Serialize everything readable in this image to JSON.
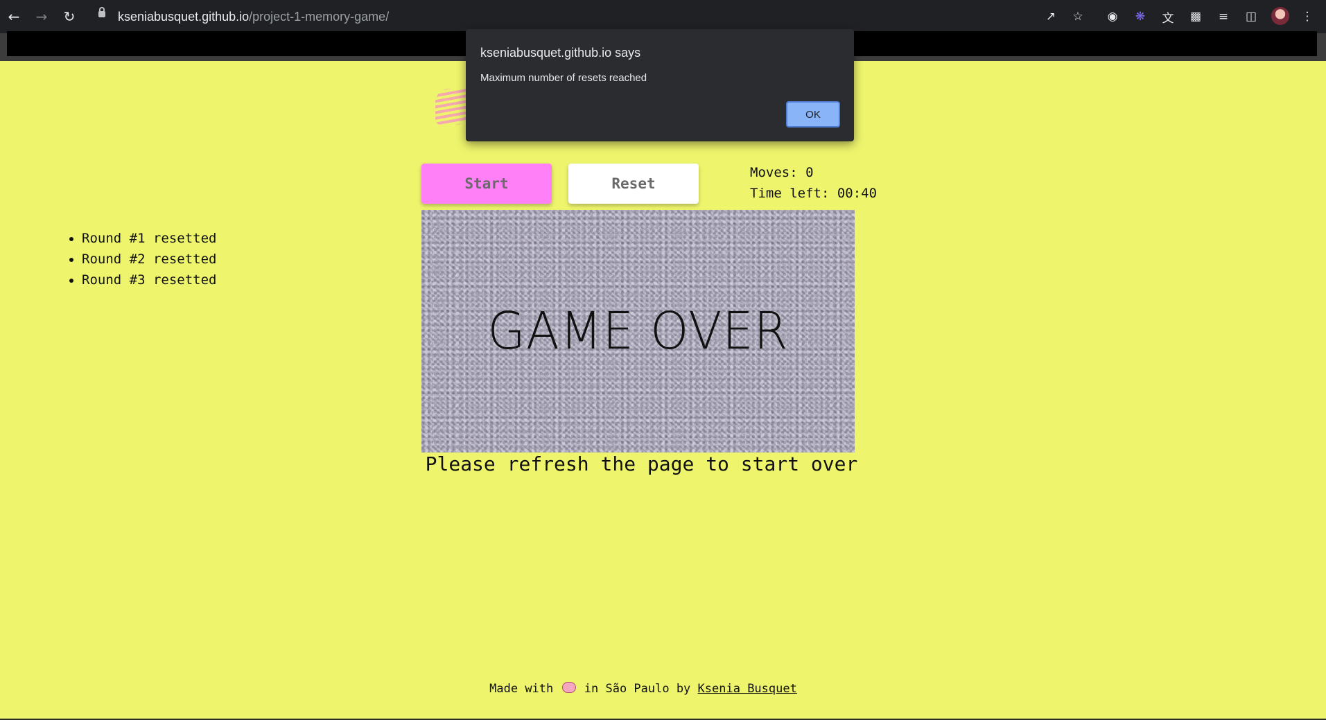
{
  "browser": {
    "url_host": "kseniabusquet.github.io",
    "url_path": "/project-1-memory-game/",
    "icons": [
      "back-icon",
      "forward-icon",
      "reload-icon",
      "lock-icon",
      "share-icon",
      "star-icon",
      "camera-icon",
      "extension-icon",
      "translate-icon",
      "puzzle-icon",
      "reading-list-icon",
      "side-panel-icon",
      "avatar",
      "menu-icon"
    ]
  },
  "dialog": {
    "title": "kseniabusquet.github.io says",
    "message": "Maximum number of resets reached",
    "ok_label": "OK"
  },
  "controls": {
    "start_label": "Start",
    "reset_label": "Reset"
  },
  "stats": {
    "moves_label": "Moves:",
    "moves_value": "0",
    "time_label": "Time left:",
    "time_value": "00:40"
  },
  "resets": [
    "Round #1 resetted",
    "Round #2 resetted",
    "Round #3 resetted"
  ],
  "board": {
    "game_over_text": "GAME OVER"
  },
  "refresh_message": "Please refresh the page to start over",
  "footer": {
    "made_with": "Made with",
    "in_city": "in São Paulo by",
    "author": "Ksenia Busquet"
  },
  "colors": {
    "page_bg": "#eef56c",
    "start_bg": "#ff80f7",
    "ok_bg": "#8ab4f8"
  }
}
